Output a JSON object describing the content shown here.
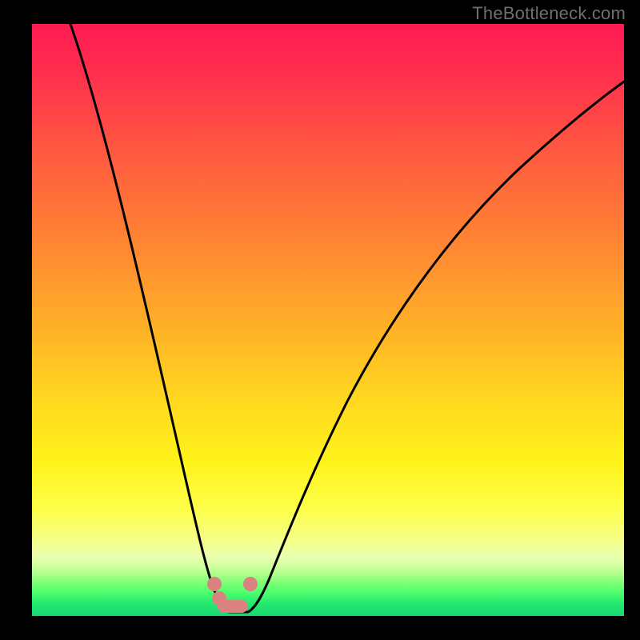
{
  "watermark": "TheBottleneck.com",
  "chart_data": {
    "type": "line",
    "title": "",
    "xlabel": "",
    "ylabel": "",
    "xlim": [
      0,
      100
    ],
    "ylim": [
      0,
      100
    ],
    "grid": false,
    "legend": false,
    "background_gradient": {
      "top_color": "#ff1a52",
      "mid_color": "#ffd91f",
      "bottom_color": "#18d872"
    },
    "series": [
      {
        "name": "bottleneck-curve",
        "color": "#000000",
        "x": [
          0,
          5,
          10,
          15,
          20,
          23,
          25,
          27,
          28,
          29,
          30,
          31,
          32,
          33,
          35,
          38,
          42,
          48,
          55,
          63,
          72,
          82,
          92,
          100
        ],
        "y": [
          100,
          86,
          72,
          55,
          36,
          22,
          12,
          5,
          2,
          1,
          1,
          1,
          2,
          4,
          9,
          18,
          30,
          44,
          56,
          66,
          74,
          80,
          84,
          86
        ]
      }
    ],
    "markers": [
      {
        "name": "notch-marker",
        "shape": "rounded-bar",
        "color": "#d9827f",
        "x_range": [
          27.5,
          32.5
        ],
        "y": 2
      }
    ],
    "annotations": []
  }
}
